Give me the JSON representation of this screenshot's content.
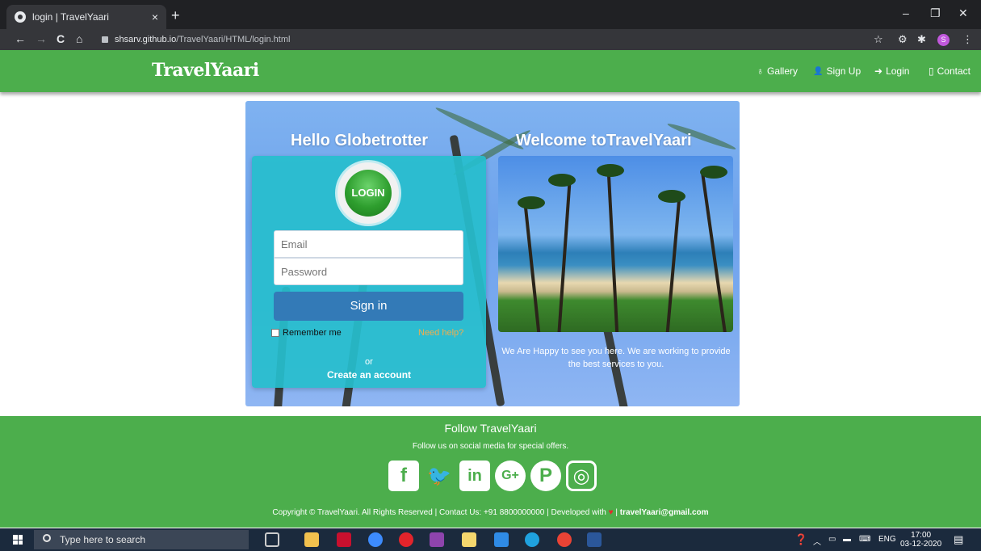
{
  "browser": {
    "tab_title": "login | TravelYaari",
    "tab_close": "×",
    "new_tab": "+",
    "url_host": "shsarv.github.io",
    "url_path": "/TravelYaari/HTML/login.html",
    "profile_initial": "S",
    "window_controls": {
      "minimize": "–",
      "maximize": "❐",
      "close": "✕"
    },
    "nav": {
      "back": "←",
      "forward": "→",
      "reload": "C",
      "home": "⌂"
    }
  },
  "header": {
    "brand": "TravelYaari",
    "nav": [
      {
        "icon": "gallery-icon",
        "glyph": "♁",
        "label": "Gallery"
      },
      {
        "icon": "user-icon",
        "glyph": "👤",
        "label": "Sign Up"
      },
      {
        "icon": "login-icon",
        "glyph": "➜",
        "label": "Login"
      },
      {
        "icon": "phone-icon",
        "glyph": "▯",
        "label": "Contact"
      }
    ]
  },
  "login": {
    "title": "Hello Globetrotter",
    "badge": "LOGIN",
    "email_placeholder": "Email",
    "password_placeholder": "Password",
    "signin_label": "Sign in",
    "remember_label": "Remember me",
    "need_help": "Need help?",
    "or_text": "or",
    "create_account": "Create an account"
  },
  "welcome": {
    "title": "Welcome toTravelYaari",
    "text": "We Are Happy to see you here. We are working to provide the best services to you."
  },
  "footer": {
    "title": "Follow TravelYaari",
    "subtitle": "Follow us on social media for special offers.",
    "social": [
      {
        "name": "facebook-icon",
        "glyph": "f"
      },
      {
        "name": "twitter-icon",
        "glyph": "🐦"
      },
      {
        "name": "linkedin-icon",
        "glyph": "in"
      },
      {
        "name": "google-plus-icon",
        "glyph": "G+"
      },
      {
        "name": "pinterest-icon",
        "glyph": "P"
      },
      {
        "name": "instagram-icon",
        "glyph": "◎"
      }
    ],
    "copyright_prefix": "Copyright © TravelYaari. All Rights Reserved | Contact Us: +91 8800000000 | Developed with",
    "heart": "♥",
    "copyright_sep": "|",
    "email": "travelYaari@gmail.com"
  },
  "taskbar": {
    "search_placeholder": "Type here to search",
    "lang": "ENG",
    "time": "17:00",
    "date": "03-12-2020"
  },
  "colors": {
    "brand_green": "#4cae4c",
    "card_teal": "#26becd",
    "signin_blue": "#337ab7",
    "help_orange": "#f0ad4e"
  }
}
